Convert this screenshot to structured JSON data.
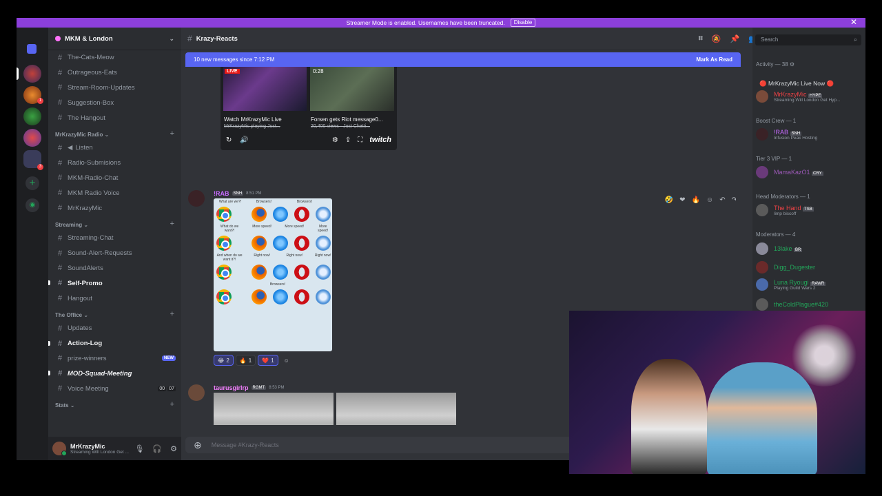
{
  "banner": {
    "text": "Streamer Mode is enabled. Usernames have been truncated.",
    "disable": "Disable"
  },
  "server": {
    "name": "MKM & London"
  },
  "channels_top": [
    "The-Cats-Meow",
    "Outrageous-Eats",
    "Stream-Room-Updates",
    "Suggestion-Box",
    "The Hangout"
  ],
  "cat_radio": "MrKrazyMic Radio",
  "channels_radio": [
    "Listen",
    "Radio-Submisions",
    "MKM-Radio-Chat",
    "MKM Radio Voice",
    "MrKrazyMic"
  ],
  "cat_streaming": "Streaming",
  "channels_streaming": [
    "Streaming-Chat",
    "Sound-Alert-Requests",
    "SoundAlerts",
    "Self-Promo",
    "Hangout"
  ],
  "cat_office": "The Office",
  "channels_office": [
    "Updates",
    "Action-Log",
    "prize-winners",
    "MOD-Squad-Meeting",
    "Voice Meeting"
  ],
  "new_badge": "NEW",
  "voice_counts": [
    "00",
    "07"
  ],
  "cat_stats": "Stats",
  "user": {
    "name": "MrKrazyMic",
    "status": "Streaming Will London Get ..."
  },
  "chat": {
    "channel": "Krazy-Reacts",
    "new_messages": "10 new messages since 7:12 PM",
    "mark_read": "Mark As Read",
    "composer_placeholder": "Message #Krazy-Reacts"
  },
  "embed": {
    "live": "LIVE",
    "duration": "0:28",
    "title1": "Watch MrKrazyMic Live",
    "sub1": "MrKrazyMic playing Just...",
    "title2": "Forsen gets Riot message0...",
    "sub2": "20,400 views · Just Chatti...",
    "twitch": "twitch"
  },
  "msg1": {
    "name": "!RAB",
    "tag": "SNH",
    "time": "8:51 PM"
  },
  "meme": {
    "rows": [
      [
        "What are we?!",
        "Browsers!",
        "Browsers!",
        "",
        ""
      ],
      [
        "What do we want?!",
        "More speed!",
        "More speed!",
        "More speed!",
        ""
      ],
      [
        "And when do we want it?!",
        "Right now!",
        "Right now!",
        "Right now!",
        ""
      ],
      [
        "",
        "Browsers!",
        "",
        "",
        ""
      ]
    ]
  },
  "reactions": [
    {
      "emoji": "😂",
      "count": "2"
    },
    {
      "emoji": "🔥",
      "count": "1"
    },
    {
      "emoji": "❤️",
      "count": "1"
    }
  ],
  "msg2": {
    "name": "taurusgirlrp",
    "tag": "RGMT",
    "time": "8:53 PM"
  },
  "search": {
    "placeholder": "Search"
  },
  "members": {
    "activity": "Activity — 38",
    "live_now": "🔴 MrKrazyMic Live Now 🔴",
    "live_user": "MrKrazyMic",
    "live_tag": "HYPE",
    "live_sub": "Streaming Will London Get Hyp...",
    "boost": "Boost Crew — 1",
    "boost_user": "!RAB",
    "boost_tag": "SNH",
    "boost_sub": "Infusion Peak Hosting",
    "tier3": "Tier 3 VIP — 1",
    "tier3_user": "MamaKazO1",
    "tier3_tag": "CRY",
    "headmods": "Head Moderators — 1",
    "head_user": "The Hand",
    "head_tag": "TSB",
    "head_sub": "limp biscoff",
    "mods": "Moderators — 4",
    "mod1": "13lake",
    "mod1_tag": "BR",
    "mod2": "Digg_Dugester",
    "mod3": "Luna Ryougi",
    "mod3_tag": "RAWR",
    "mod3_sub": "Playing Guild Wars 2",
    "mod4": "theColdPlague#420"
  },
  "colors": {
    "accent": "#5865f2",
    "banner": "#8c3fdb",
    "online": "#23a55a"
  }
}
